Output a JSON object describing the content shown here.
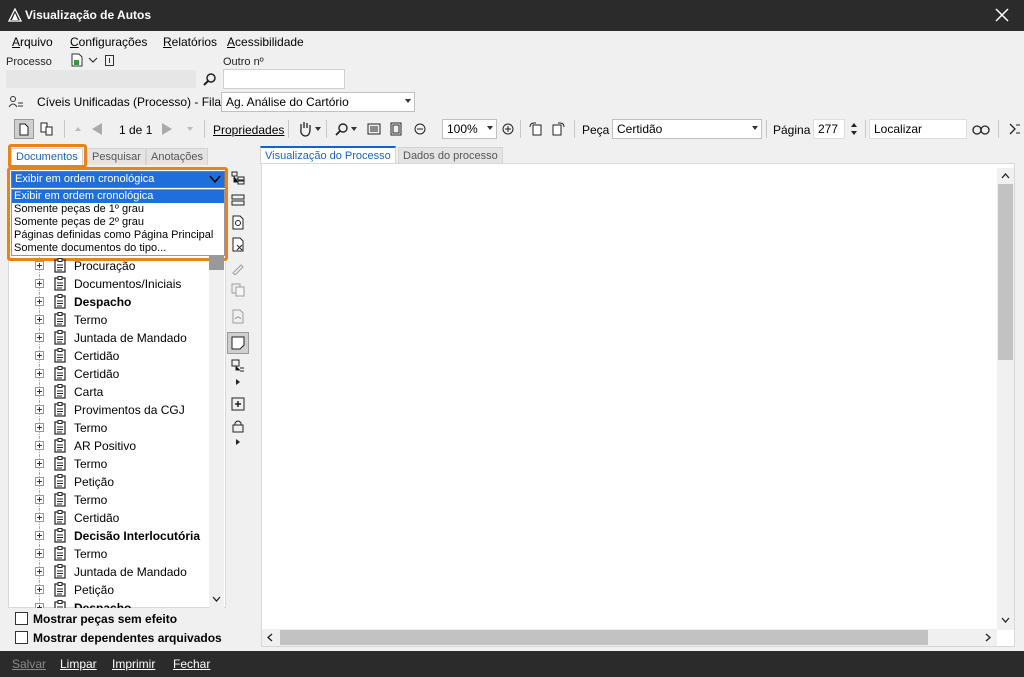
{
  "window": {
    "title": "Visualização de Autos"
  },
  "menu": [
    {
      "label": "Arquivo",
      "hot": "A",
      "rest": "rquivo"
    },
    {
      "label": "Configurações",
      "hot": "C",
      "rest": "onfigurações"
    },
    {
      "label": "Relatórios",
      "hot": "R",
      "rest": "elatórios"
    },
    {
      "label": "Acessibilidade",
      "hot": "A",
      "rest": "cessibilidade"
    }
  ],
  "fields": {
    "processo_label": "Processo",
    "outro_label": "Outro nº",
    "outro_value": ""
  },
  "queue": {
    "label": "Cíveis Unificadas (Processo) - Fila:",
    "selected": "Ag. Análise do Cartório"
  },
  "toolbar": {
    "page_of": "1 de 1",
    "properties": "Propriedades",
    "zoom": "100%",
    "peca_label": "Peça",
    "peca_value": "Certidão",
    "pagina_label": "Página",
    "pagina_value": "277",
    "find_value": "Localizar"
  },
  "left_tabs": [
    "Documentos",
    "Pesquisar",
    "Anotações"
  ],
  "order_select": {
    "selected": "Exibir em ordem cronológica",
    "options": [
      "Exibir em ordem cronológica",
      "Somente peças de 1º grau",
      "Somente peças de 2º grau",
      "Páginas definidas como Página Principal",
      "Somente documentos do tipo..."
    ]
  },
  "tree": [
    {
      "label": "Procuração",
      "bold": false
    },
    {
      "label": "Documentos/Iniciais",
      "bold": false
    },
    {
      "label": "Despacho",
      "bold": true
    },
    {
      "label": "Termo",
      "bold": false
    },
    {
      "label": "Juntada de Mandado",
      "bold": false
    },
    {
      "label": "Certidão",
      "bold": false
    },
    {
      "label": "Certidão",
      "bold": false
    },
    {
      "label": "Carta",
      "bold": false
    },
    {
      "label": "Provimentos da CGJ",
      "bold": false
    },
    {
      "label": "Termo",
      "bold": false
    },
    {
      "label": "AR Positivo",
      "bold": false
    },
    {
      "label": "Termo",
      "bold": false
    },
    {
      "label": "Petição",
      "bold": false
    },
    {
      "label": "Termo",
      "bold": false
    },
    {
      "label": "Certidão",
      "bold": false
    },
    {
      "label": "Decisão Interlocutória",
      "bold": true
    },
    {
      "label": "Termo",
      "bold": false
    },
    {
      "label": "Juntada de Mandado",
      "bold": false
    },
    {
      "label": "Petição",
      "bold": false
    },
    {
      "label": "Despacho",
      "bold": true
    }
  ],
  "checkboxes": [
    {
      "label": "Mostrar peças sem efeito",
      "checked": false
    },
    {
      "label": "Mostrar dependentes arquivados",
      "checked": false
    }
  ],
  "viewer_tabs": [
    "Visualização do Processo",
    "Dados do processo"
  ],
  "bottom": {
    "salvar": "Salvar",
    "limpar": "Limpar",
    "imprimir": "Imprimir",
    "fechar": "Fechar"
  },
  "colors": {
    "accent": "#e8821a",
    "selection": "#1e6fd9",
    "tab_active_text": "#1565c0"
  }
}
